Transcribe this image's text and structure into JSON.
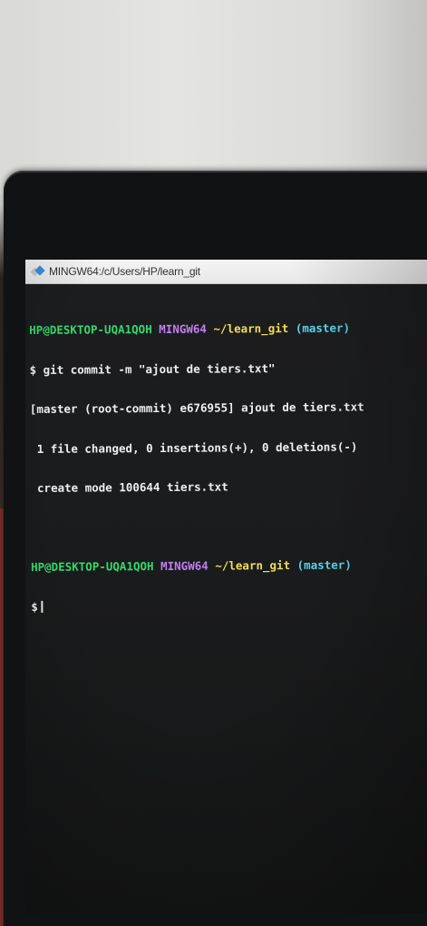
{
  "window": {
    "title": "MINGW64:/c/Users/HP/learn_git",
    "icon": "git-bash-icon"
  },
  "terminal": {
    "prompt1": {
      "user_host": "HP@DESKTOP-UQA1QOH",
      "shell": "MINGW64",
      "path": "~/learn_git",
      "branch": "(master)"
    },
    "command": "$ git commit -m \"ajout de tiers.txt\"",
    "output": [
      "[master (root-commit) e676955] ajout de tiers.txt",
      " 1 file changed, 0 insertions(+), 0 deletions(-)",
      " create mode 100644 tiers.txt"
    ],
    "prompt2": {
      "user_host": "HP@DESKTOP-UQA1QOH",
      "shell": "MINGW64",
      "path": "~/learn_git",
      "branch": "(master)"
    },
    "input_prompt": "$"
  },
  "colors": {
    "user_host": "#35d96c",
    "shell": "#c27ff0",
    "path": "#f0dd5a",
    "branch": "#5ad2ea",
    "text": "#efefef",
    "background": "#1a1b1c"
  }
}
